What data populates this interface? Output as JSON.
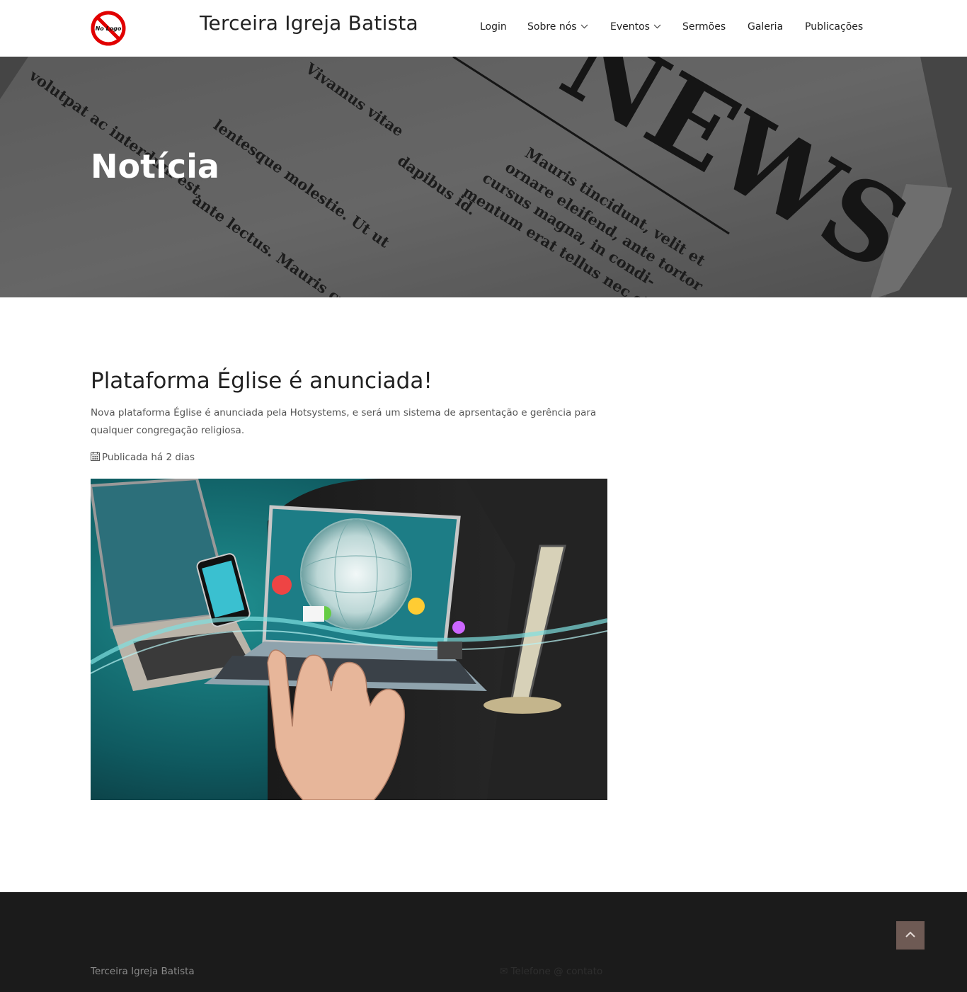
{
  "header": {
    "logo_text": "No Logo",
    "site_title": "Terceira Igreja Batista",
    "nav": [
      {
        "label": "Login",
        "has_dropdown": false
      },
      {
        "label": "Sobre nós",
        "has_dropdown": true
      },
      {
        "label": "Eventos",
        "has_dropdown": true
      },
      {
        "label": "Sermões",
        "has_dropdown": false
      },
      {
        "label": "Galeria",
        "has_dropdown": false
      },
      {
        "label": "Publicações",
        "has_dropdown": false
      }
    ]
  },
  "hero": {
    "title": "Notícia",
    "background": "newspaper-photo",
    "newspaper_text": [
      "NEWS",
      "Mauris tincidunt, velit et",
      "ornare eleifend, ante tortor",
      "cursus magna, in condi-",
      "mentum erat tellus nec elit.",
      "lentesque molestie. Ut ut",
      "ante lectus. Mauris cursus",
      "volutpat ac interdum est.",
      "Vivamus vitae",
      "dapibus id."
    ]
  },
  "article": {
    "title": "Plataforma Église é anunciada!",
    "summary": "Nova plataforma Église é anunciada pela Hotsystems, e será um sistema de aprsentação e gerência para qualquer congregação religiosa.",
    "date_icon": "calendar-icon",
    "date": "Publicada há 2 dias",
    "image": "technology-hand-devices-photo"
  },
  "footer": {
    "name": "Terceira Igreja Batista",
    "contact": "✉ Telefone @ contato",
    "back_to_top_icon": "chevron-up-icon"
  },
  "colors": {
    "header_bg": "#ffffff",
    "footer_bg": "#1b1b1b",
    "back_to_top": "#6e5a54",
    "logo_red": "#e10000"
  }
}
